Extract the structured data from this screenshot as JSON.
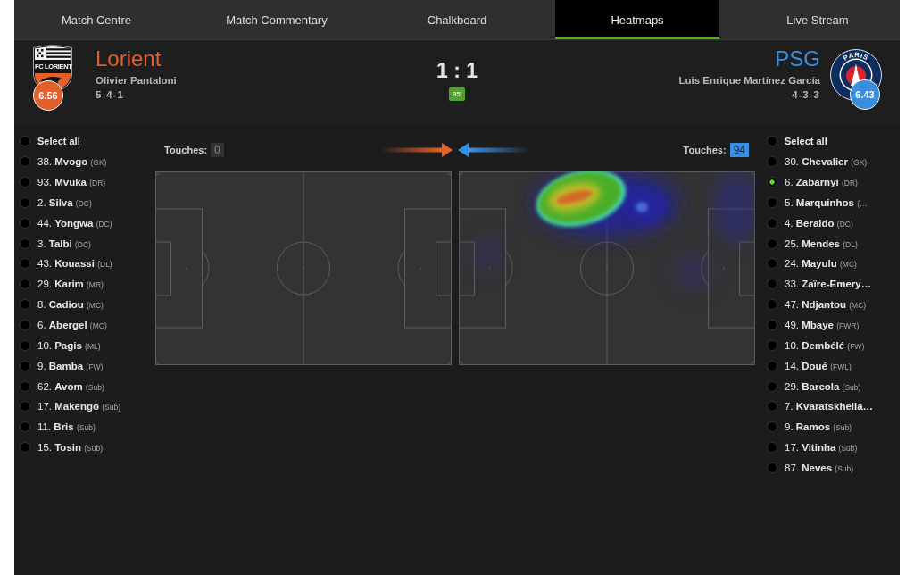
{
  "tabs": [
    {
      "label": "Match Centre",
      "selected": false
    },
    {
      "label": "Match Commentary",
      "selected": false
    },
    {
      "label": "Chalkboard",
      "selected": false
    },
    {
      "label": "Heatmaps",
      "selected": true
    },
    {
      "label": "Live Stream",
      "selected": false
    }
  ],
  "score": {
    "text": "1 : 1",
    "minute": "85'"
  },
  "teams": [
    {
      "name": "Lorient",
      "color": "#e3602a",
      "crest": {
        "kind": "shield",
        "text": "FC LORIENT"
      },
      "rating": "6.56",
      "manager": "Olivier Pantaloni",
      "formation": "5-4-1",
      "touches_label": "Touches:",
      "touches": "0",
      "select_all": {
        "label": "Select all",
        "selected": false
      },
      "players": [
        {
          "number": "38.",
          "name": "Mvogo",
          "position": "(GK)",
          "selected": false
        },
        {
          "number": "93.",
          "name": "Mvuka",
          "position": "(DR)",
          "selected": false
        },
        {
          "number": "2.",
          "name": "Silva",
          "position": "(DC)",
          "selected": false
        },
        {
          "number": "44.",
          "name": "Yongwa",
          "position": "(DC)",
          "selected": false
        },
        {
          "number": "3.",
          "name": "Talbi",
          "position": "(DC)",
          "selected": false
        },
        {
          "number": "43.",
          "name": "Kouassi",
          "position": "(DL)",
          "selected": false
        },
        {
          "number": "29.",
          "name": "Karim",
          "position": "(MR)",
          "selected": false
        },
        {
          "number": "8.",
          "name": "Cadiou",
          "position": "(MC)",
          "selected": false
        },
        {
          "number": "6.",
          "name": "Abergel",
          "position": "(MC)",
          "selected": false
        },
        {
          "number": "10.",
          "name": "Pagis",
          "position": "(ML)",
          "selected": false
        },
        {
          "number": "9.",
          "name": "Bamba",
          "position": "(FW)",
          "selected": false
        },
        {
          "number": "62.",
          "name": "Avom",
          "position": "(Sub)",
          "selected": false
        },
        {
          "number": "17.",
          "name": "Makengo",
          "position": "(Sub)",
          "selected": false
        },
        {
          "number": "11.",
          "name": "Bris",
          "position": "(Sub)",
          "selected": false
        },
        {
          "number": "15.",
          "name": "Tosin",
          "position": "(Sub)",
          "selected": false
        }
      ]
    },
    {
      "name": "PSG",
      "color": "#3a8ee0",
      "crest": {
        "kind": "roundel",
        "text": "PARIS"
      },
      "rating": "6.43",
      "manager": "Luis Enrique Martínez García",
      "formation": "4-3-3",
      "touches_label": "Touches:",
      "touches": "94",
      "select_all": {
        "label": "Select all",
        "selected": false
      },
      "players": [
        {
          "number": "30.",
          "name": "Chevalier",
          "position": "(GK)",
          "selected": false
        },
        {
          "number": "6.",
          "name": "Zabarnyi",
          "position": "(DR)",
          "selected": true
        },
        {
          "number": "5.",
          "name": "Marquinhos",
          "position": "(…",
          "selected": false
        },
        {
          "number": "4.",
          "name": "Beraldo",
          "position": "(DC)",
          "selected": false
        },
        {
          "number": "25.",
          "name": "Mendes",
          "position": "(DL)",
          "selected": false
        },
        {
          "number": "24.",
          "name": "Mayulu",
          "position": "(MC)",
          "selected": false
        },
        {
          "number": "33.",
          "name": "Zaïre-Emery…",
          "selected": false
        },
        {
          "number": "47.",
          "name": "Ndjantou",
          "position": "(MC)",
          "selected": false
        },
        {
          "number": "49.",
          "name": "Mbaye",
          "position": "(FWR)",
          "selected": false
        },
        {
          "number": "10.",
          "name": "Dembélé",
          "position": "(FW)",
          "selected": false
        },
        {
          "number": "14.",
          "name": "Doué",
          "position": "(FWL)",
          "selected": false
        },
        {
          "number": "29.",
          "name": "Barcola",
          "position": "(Sub)",
          "selected": false
        },
        {
          "number": "7.",
          "name": "Kvaratskhelia…",
          "selected": false
        },
        {
          "number": "9.",
          "name": "Ramos",
          "position": "(Sub)",
          "selected": false
        },
        {
          "number": "17.",
          "name": "Vitinha",
          "position": "(Sub)",
          "selected": false
        },
        {
          "number": "87.",
          "name": "Neves",
          "position": "(Sub)",
          "selected": false
        }
      ]
    }
  ]
}
